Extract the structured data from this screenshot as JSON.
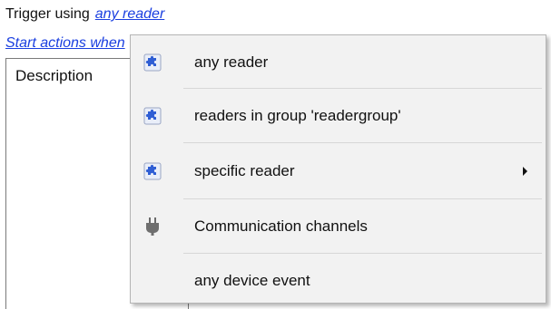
{
  "trigger": {
    "label": "Trigger using",
    "link_text": "any reader"
  },
  "start_actions": {
    "link_text": "Start actions when"
  },
  "description_panel": {
    "label": "Description"
  },
  "menu": {
    "items": [
      {
        "label": "any reader",
        "icon": "puzzle-piece-icon",
        "has_submenu": false
      },
      {
        "label": "readers in group 'readergroup'",
        "icon": "puzzle-piece-icon",
        "has_submenu": false
      },
      {
        "label": "specific reader",
        "icon": "puzzle-piece-icon",
        "has_submenu": true
      },
      {
        "label": "Communication channels",
        "icon": "plug-icon",
        "has_submenu": false
      },
      {
        "label": "any device event",
        "icon": "",
        "has_submenu": false
      }
    ]
  },
  "colors": {
    "link": "#1a3fe0",
    "menu_background": "#f2f2f2",
    "menu_border": "#b5b5b5",
    "separator": "#d7d7d7",
    "puzzle_blue": "#2f5ed4"
  }
}
